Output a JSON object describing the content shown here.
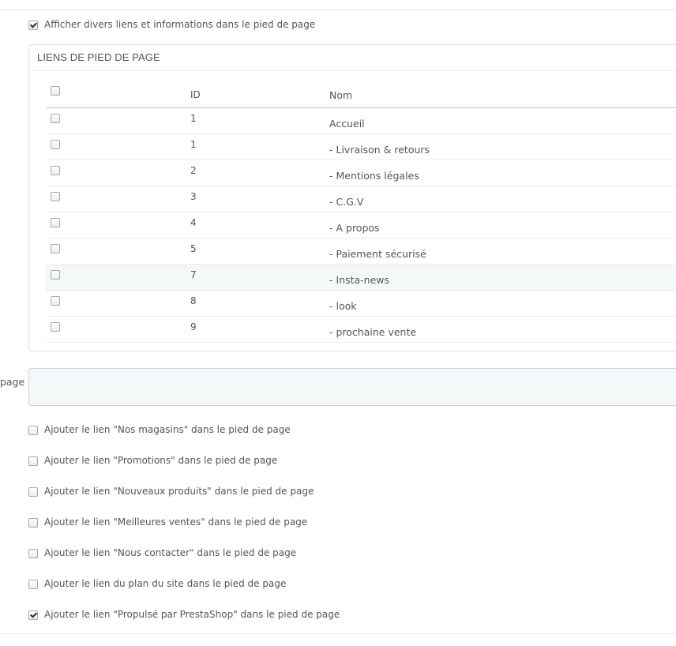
{
  "top_option": {
    "label": "Afficher divers liens et informations dans le pied de page",
    "checked": true
  },
  "footer_links_panel": {
    "title": "LIENS DE PIED DE PAGE",
    "columns": {
      "id": "ID",
      "name": "Nom"
    },
    "rows": [
      {
        "id": "1",
        "name": "Accueil"
      },
      {
        "id": "1",
        "name": "- Livraison & retours"
      },
      {
        "id": "2",
        "name": "- Mentions légales"
      },
      {
        "id": "3",
        "name": "- C.G.V"
      },
      {
        "id": "4",
        "name": "- A propos"
      },
      {
        "id": "5",
        "name": "- Paiement sécurisé"
      },
      {
        "id": "7",
        "name": "- Insta-news"
      },
      {
        "id": "8",
        "name": "- look"
      },
      {
        "id": "9",
        "name": "- prochaine vente"
      }
    ]
  },
  "text_field": {
    "label_fragment": "page",
    "value": ""
  },
  "options": [
    {
      "label": "Ajouter le lien \"Nos magasins\" dans le pied de page",
      "checked": false
    },
    {
      "label": "Ajouter le lien \"Promotions\" dans le pied de page",
      "checked": false
    },
    {
      "label": "Ajouter le lien \"Nouveaux produits\" dans le pied de page",
      "checked": false
    },
    {
      "label": "Ajouter le lien \"Meilleures ventes\" dans le pied de page",
      "checked": false
    },
    {
      "label": "Ajouter le lien \"Nous contacter\" dans le pied de page",
      "checked": false
    },
    {
      "label": "Ajouter le lien du plan du site dans le pied de page",
      "checked": false
    },
    {
      "label": "Ajouter le lien \"Propulsé par PrestaShop\" dans le pied de page",
      "checked": true
    }
  ]
}
